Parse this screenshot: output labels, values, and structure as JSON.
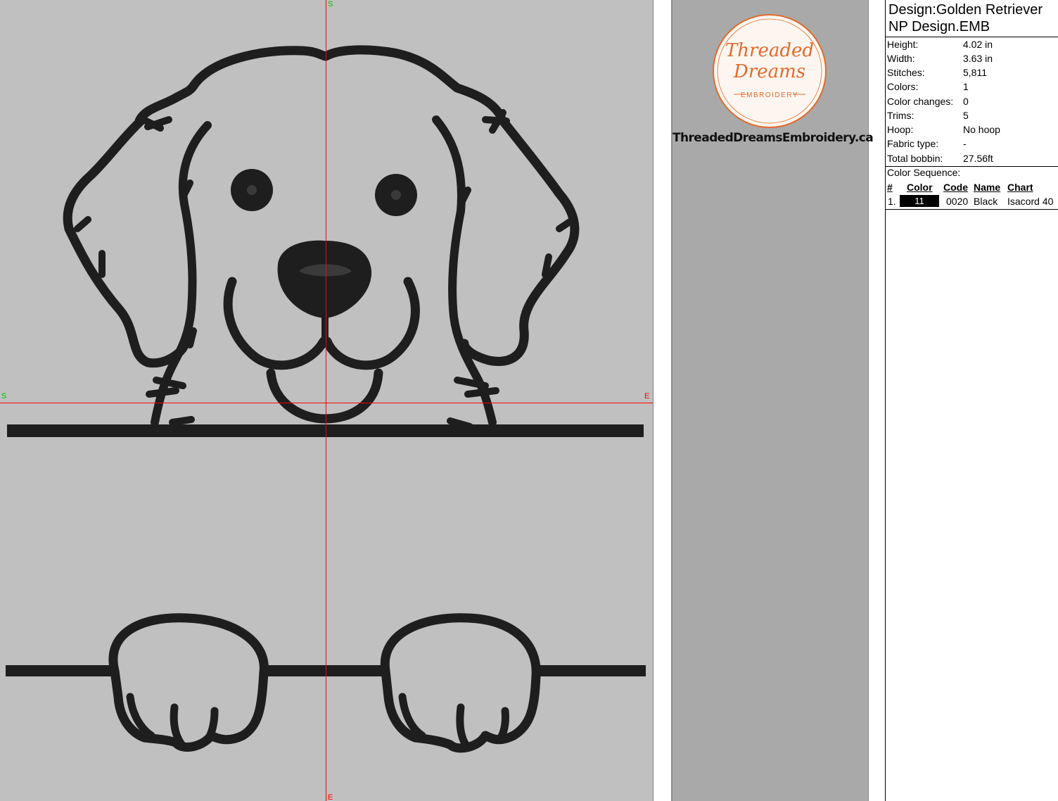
{
  "canvas": {
    "axis_labels": {
      "top": "S",
      "left": "S",
      "right": "E",
      "bottom": "E"
    }
  },
  "logo": {
    "brand_line1": "Threaded",
    "brand_line2": "Dreams",
    "brand_sub": "EMBROIDERY",
    "accent_color": "#e26a2c",
    "website": "ThreadedDreamsEmbroidery.ca"
  },
  "info": {
    "design_line1": "Design:Golden Retriever",
    "design_line2": "NP Design.EMB",
    "fields": [
      {
        "label": "Height:",
        "value": "4.02 in"
      },
      {
        "label": "Width:",
        "value": "3.63 in"
      },
      {
        "label": "Stitches:",
        "value": "5,811"
      },
      {
        "label": "Colors:",
        "value": "1"
      },
      {
        "label": "Color changes:",
        "value": "0"
      },
      {
        "label": "Trims:",
        "value": "5"
      },
      {
        "label": "Hoop:",
        "value": "No hoop"
      },
      {
        "label": "Fabric type:",
        "value": "-"
      },
      {
        "label": "Total bobbin:",
        "value": "27.56ft"
      }
    ],
    "color_sequence_label": "Color Sequence:",
    "columns": {
      "num": "#",
      "color": "Color",
      "code": "Code",
      "name": "Name",
      "chart": "Chart"
    },
    "rows": [
      {
        "num": "1.",
        "color_number": "11",
        "swatch": "#000000",
        "code": "0020",
        "name": "Black",
        "chart": "Isacord 40"
      }
    ]
  }
}
